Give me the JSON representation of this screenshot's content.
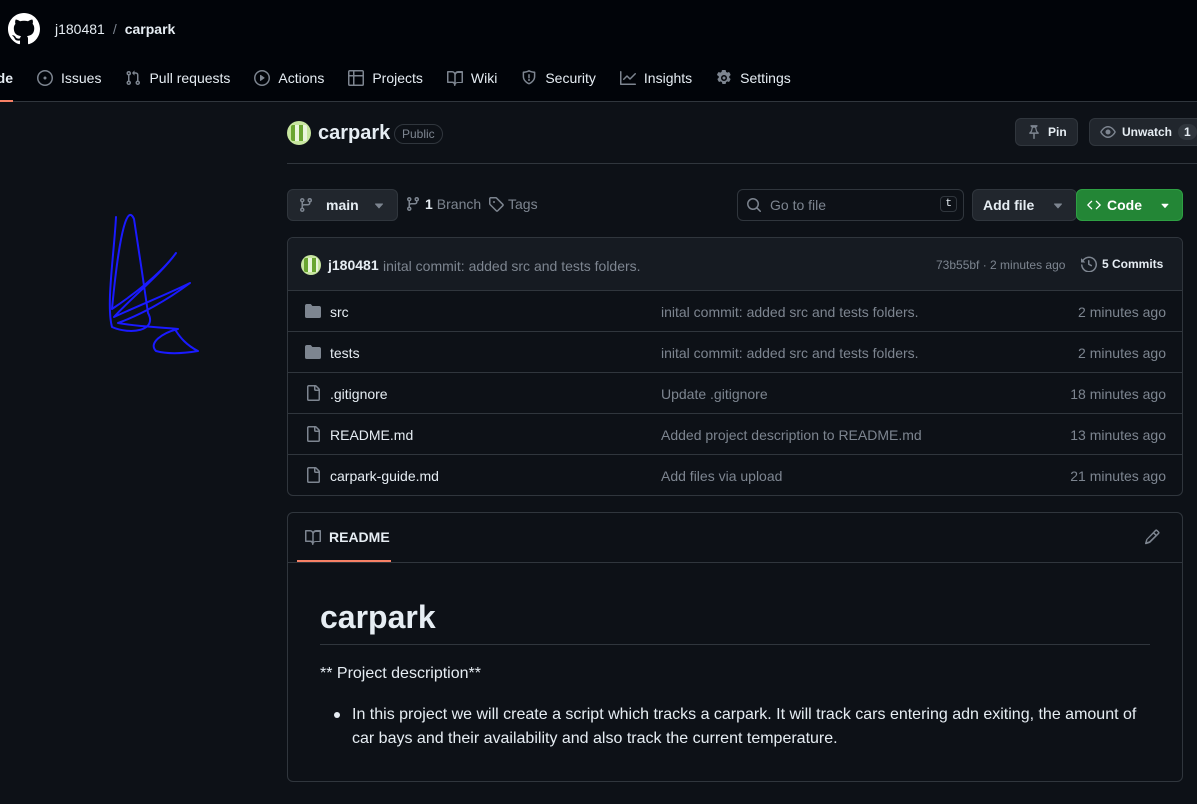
{
  "header": {
    "owner": "j180481",
    "separator": "/",
    "repo": "carpark"
  },
  "nav": {
    "items": [
      {
        "label": "Code",
        "active": true
      },
      {
        "label": "Issues"
      },
      {
        "label": "Pull requests"
      },
      {
        "label": "Actions"
      },
      {
        "label": "Projects"
      },
      {
        "label": "Wiki"
      },
      {
        "label": "Security"
      },
      {
        "label": "Insights"
      },
      {
        "label": "Settings"
      }
    ]
  },
  "repo": {
    "title": "carpark",
    "visibility": "Public",
    "pin_label": "Pin",
    "watch_label": "Unwatch",
    "watch_count": "1"
  },
  "toolbar": {
    "branch": "main",
    "branch_count": "1",
    "branch_label": "Branch",
    "tags_label": "Tags",
    "search_placeholder": "Go to file",
    "search_shortcut": "t",
    "add_file_label": "Add file",
    "code_label": "Code"
  },
  "latest_commit": {
    "user": "j180481",
    "message": "inital commit: added src and tests folders.",
    "meta": "73b55bf · 2 minutes ago",
    "commits_label": "5 Commits"
  },
  "files": [
    {
      "type": "folder",
      "name": "src",
      "message": "inital commit: added src and tests folders.",
      "time": "2 minutes ago"
    },
    {
      "type": "folder",
      "name": "tests",
      "message": "inital commit: added src and tests folders.",
      "time": "2 minutes ago"
    },
    {
      "type": "file",
      "name": ".gitignore",
      "message": "Update .gitignore",
      "time": "18 minutes ago"
    },
    {
      "type": "file",
      "name": "README.md",
      "message": "Added project description to README.md",
      "time": "13 minutes ago"
    },
    {
      "type": "file",
      "name": "carpark-guide.md",
      "message": "Add files via upload",
      "time": "21 minutes ago"
    }
  ],
  "readme": {
    "tab_label": "README",
    "h1": "carpark",
    "paragraph": "** Project description**",
    "list": [
      "In this project we will create a script which tracks a carpark. It will track cars entering adn exiting, the amount of car bays and their availability and also track the current temperature."
    ]
  },
  "colors": {
    "background": "#0d1117",
    "header_bg": "#010409",
    "accent_underline": "#f78166",
    "code_button": "#238636",
    "scribble": "#1a1aff"
  }
}
